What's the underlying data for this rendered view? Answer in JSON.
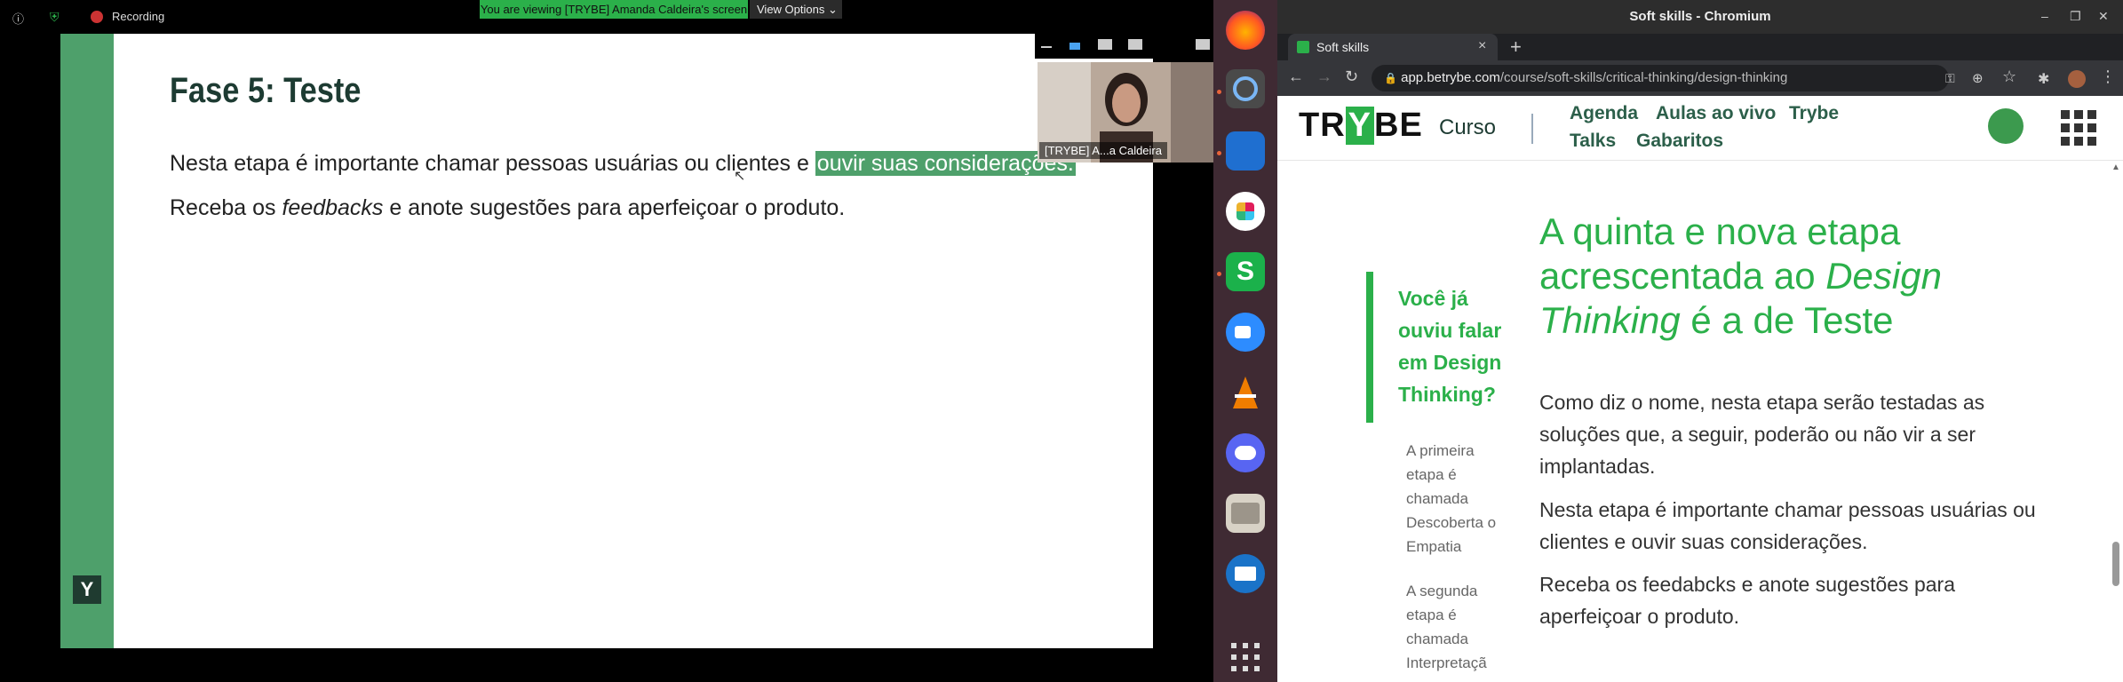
{
  "zoom": {
    "recording_label": "Recording",
    "viewing_banner": "You are viewing [TRYBE] Amanda Caldeira's screen",
    "view_options": "View Options",
    "participant_label": "[TRYBE] A...a Caldeira",
    "slide": {
      "title": "Fase 5: Teste",
      "line1_prefix": "Nesta etapa é importante chamar pessoas usuárias ou clientes e ",
      "line1_highlight": "ouvir suas considerações.",
      "line2_prefix": "Receba os ",
      "line2_italic": "feedbacks",
      "line2_suffix": " e anote sugestões para aperfeiçoar o produto.",
      "logo": "Y"
    }
  },
  "dock": {
    "icons": [
      "firefox-icon",
      "chromium-icon",
      "vscode-icon",
      "slack-icon",
      "wps-icon",
      "zoom-icon",
      "vlc-icon",
      "discord-icon",
      "files-icon",
      "thunderbird-icon",
      "apps-grid-icon"
    ]
  },
  "browser": {
    "window_title": "Soft skills - Chromium",
    "tab_title": "Soft skills",
    "url_domain": "app.betrybe.com",
    "url_path": "/course/soft-skills/critical-thinking/design-thinking",
    "new_tab": "+",
    "tab_close": "×"
  },
  "page": {
    "brand_prefix": "TR",
    "brand_box": "Y",
    "brand_suffix": "BE",
    "curso": "Curso",
    "nav": {
      "agenda": "Agenda",
      "aulas": "Aulas ao vivo",
      "trybe": "Trybe",
      "talks": "Talks",
      "gabaritos": "Gabaritos"
    },
    "sidebar": {
      "question": "Você já ouviu falar em Design Thinking?",
      "item1": [
        "A primeira",
        "etapa é",
        "chamada",
        "Descoberta o",
        "Empatia"
      ],
      "item2": [
        "A segunda",
        "etapa é",
        "chamada",
        "Interpretaçã"
      ]
    },
    "headline": {
      "part1": "A quinta e nova etapa acrescentada ao ",
      "italic": "Design Thinking",
      "part2": " é a de Teste"
    },
    "paragraphs": [
      "Como diz o nome, nesta etapa serão testadas as soluções que, a seguir, poderão ou não vir a ser implantadas.",
      "Nesta etapa é importante chamar pessoas usuárias ou clientes e ouvir suas considerações.",
      "Receba os feedabcks e anote sugestões para aperfeiçoar o produto."
    ]
  }
}
